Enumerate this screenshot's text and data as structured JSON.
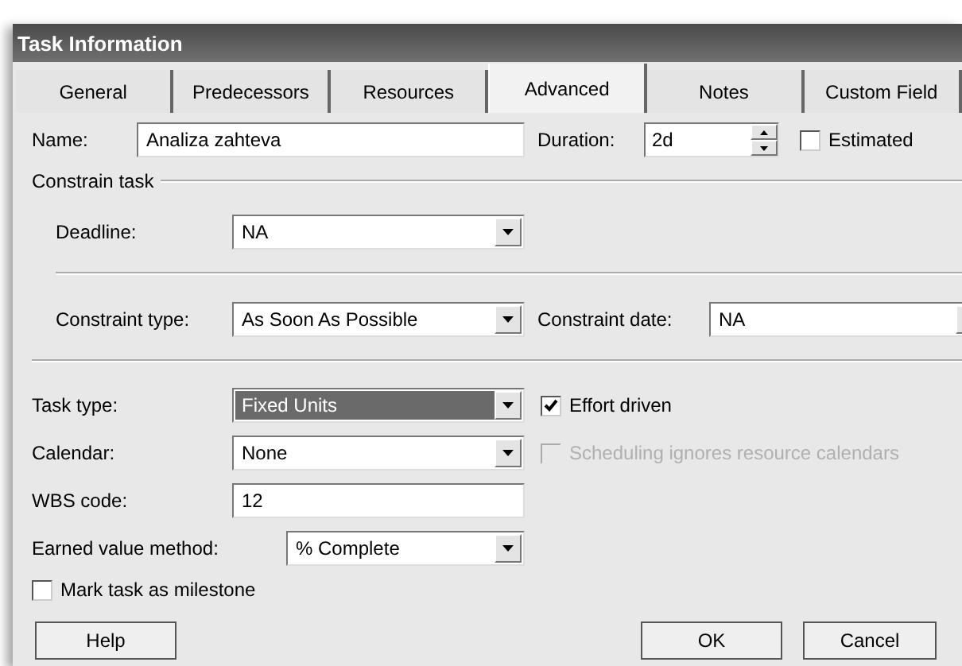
{
  "window": {
    "title": "Task Information"
  },
  "tabs": [
    {
      "label": "General",
      "selected": false
    },
    {
      "label": "Predecessors",
      "selected": false
    },
    {
      "label": "Resources",
      "selected": false
    },
    {
      "label": "Advanced",
      "selected": true
    },
    {
      "label": "Notes",
      "selected": false
    },
    {
      "label": "Custom Field",
      "selected": false
    }
  ],
  "name": {
    "label": "Name:",
    "value": "Analiza zahteva"
  },
  "duration": {
    "label": "Duration:",
    "value": "2d"
  },
  "estimated": {
    "label": "Estimated",
    "checked": false,
    "disabled": false
  },
  "constrain_task": {
    "title": "Constrain task",
    "deadline": {
      "label": "Deadline:",
      "value": "NA"
    },
    "constraint_type": {
      "label": "Constraint type:",
      "value": "As Soon As Possible"
    },
    "constraint_date": {
      "label": "Constraint date:",
      "value": "NA"
    }
  },
  "task_type": {
    "label": "Task type:",
    "value": "Fixed Units",
    "highlighted": true
  },
  "effort_driven": {
    "label": "Effort driven",
    "checked": true,
    "disabled": false
  },
  "calendar": {
    "label": "Calendar:",
    "value": "None"
  },
  "scheduling_ignores_calendars": {
    "label": "Scheduling ignores resource calendars",
    "checked": false,
    "disabled": true
  },
  "wbs_code": {
    "label": "WBS code:",
    "value": "12"
  },
  "earned_value_method": {
    "label": "Earned value method:",
    "value": "% Complete"
  },
  "mark_as_milestone": {
    "label": "Mark task as milestone",
    "checked": false,
    "disabled": false
  },
  "buttons": [
    "Help",
    "OK",
    "Cancel"
  ]
}
